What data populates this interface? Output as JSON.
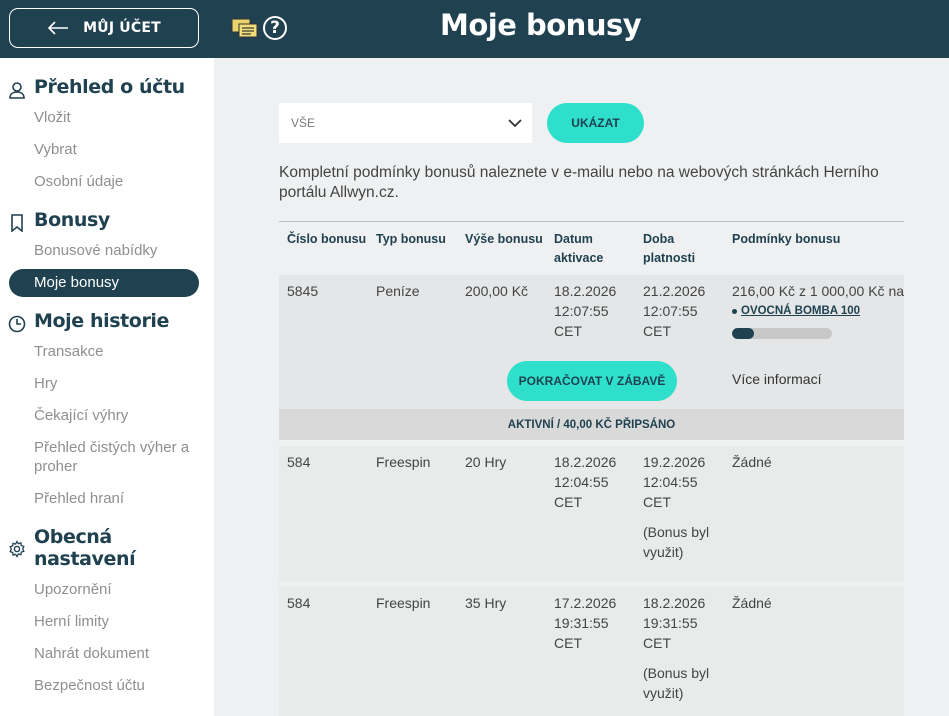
{
  "header": {
    "account_button": "MŮJ ÚČET",
    "title": "Moje bonusy",
    "help_glyph": "?"
  },
  "sidebar": {
    "sections": [
      {
        "title": "Přehled o účtu",
        "icon": "user-icon",
        "items": [
          "Vložit",
          "Vybrat",
          "Osobní údaje"
        ]
      },
      {
        "title": "Bonusy",
        "icon": "bookmark-icon",
        "items": [
          "Bonusové nabídky",
          "Moje bonusy"
        ]
      },
      {
        "title": "Moje historie",
        "icon": "clock-icon",
        "items": [
          "Transakce",
          "Hry",
          "Čekající výhry",
          "Přehled čistých výher a proher",
          "Přehled hraní"
        ]
      },
      {
        "title": "Obecná nastavení",
        "icon": "gear-icon",
        "items": [
          "Upozornění",
          "Herní limity",
          "Nahrát dokument",
          "Bezpečnost účtu"
        ]
      }
    ],
    "active_item": "Moje bonusy"
  },
  "filter": {
    "selected": "VŠE",
    "show_button": "UKÁZAT"
  },
  "info_text": "Kompletní podmínky bonusů naleznete v e-mailu nebo na webových stránkách Herního portálu Allwyn.cz.",
  "table": {
    "headers": [
      "Číslo bonusu",
      "Typ bonusu",
      "Výše bonusu",
      "Datum aktivace",
      "Doba platnosti",
      "Podmínky bonusu"
    ],
    "rows": [
      {
        "id": "5845",
        "type": "Peníze",
        "amount": "200,00 Kč",
        "activation": [
          "18.2.2026",
          "12:07:55",
          "CET"
        ],
        "validity": [
          "21.2.2026",
          "12:07:55",
          "CET"
        ],
        "conditions": "216,00 Kč z 1 000,00 Kč na",
        "game_link": "OVOCNÁ BOMBA 100",
        "progress": 0.216,
        "continue_button": "POKRAČOVAT V ZÁBAVĚ",
        "more_info": "Více informací",
        "status": "AKTIVNÍ / 40,00 KČ PŘIPSÁNO"
      },
      {
        "id": "584",
        "type": "Freespin",
        "amount": "20 Hry",
        "activation": [
          "18.2.2026",
          "12:04:55",
          "CET"
        ],
        "validity": [
          "19.2.2026",
          "12:04:55",
          "CET"
        ],
        "validity_note": [
          "(Bonus byl",
          "využit)"
        ],
        "conditions": "Žádné"
      },
      {
        "id": "584",
        "type": "Freespin",
        "amount": "35 Hry",
        "activation": [
          "17.2.2026",
          "19:31:55",
          "CET"
        ],
        "validity": [
          "18.2.2026",
          "19:31:55",
          "CET"
        ],
        "validity_note": [
          "(Bonus byl",
          "využit)"
        ],
        "conditions": "Žádné"
      }
    ]
  },
  "colors": {
    "primary": "#1f4150",
    "accent": "#2ee0cc",
    "background": "#eef0f1"
  }
}
